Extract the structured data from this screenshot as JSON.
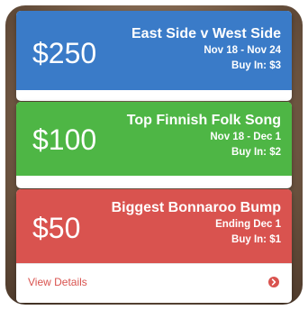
{
  "cards": [
    {
      "amount": "$250",
      "title": "East Side v West Side",
      "dates": "Nov 18 - Nov 24",
      "buy_in": "Buy In: $3",
      "color": "#3a7bc8"
    },
    {
      "amount": "$100",
      "title": "Top Finnish Folk Song",
      "dates": "Nov 18 - Dec 1",
      "buy_in": "Buy In: $2",
      "color": "#4eb645"
    },
    {
      "amount": "$50",
      "title": "Biggest Bonnaroo Bump",
      "dates": "Ending Dec 1",
      "buy_in": "Buy In: $1",
      "color": "#d9534f",
      "footer": {
        "link_label": "View Details",
        "icon": "arrow-circle-right-icon"
      }
    }
  ]
}
